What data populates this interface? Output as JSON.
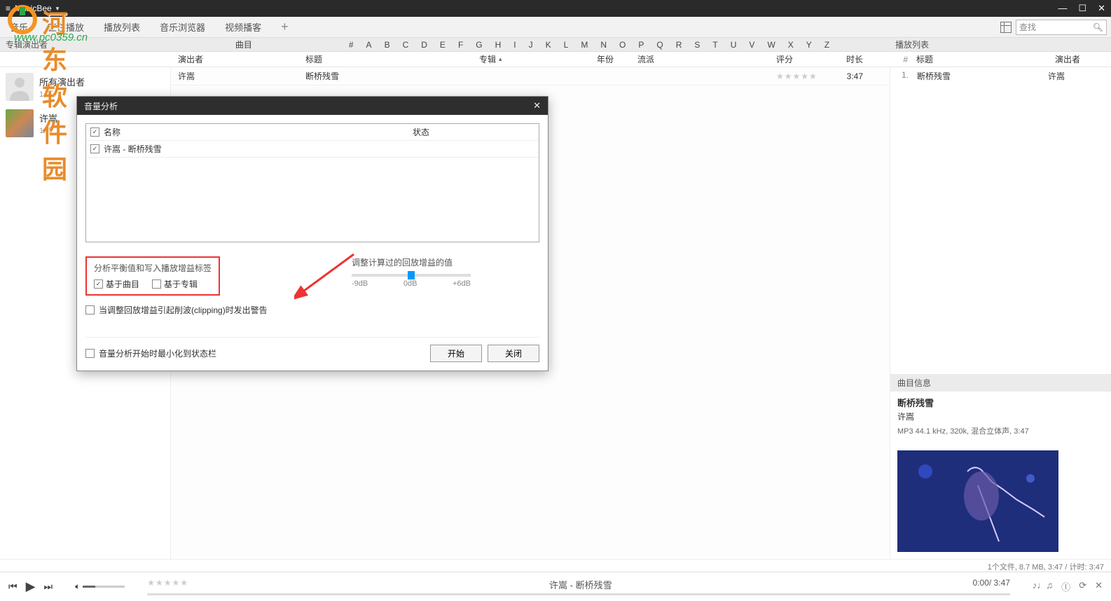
{
  "app": {
    "title": "MusicBee"
  },
  "window": {
    "min": "—",
    "max": "☐",
    "close": "✕"
  },
  "menu": {
    "items": [
      "音乐",
      "正在播放",
      "播放列表",
      "音乐浏览器",
      "视频播客"
    ],
    "search_placeholder": "查找"
  },
  "colstrip": {
    "left": "专辑演出者",
    "mid_prefix": "曲目",
    "alpha": [
      "#",
      "A",
      "B",
      "C",
      "D",
      "E",
      "F",
      "G",
      "H",
      "I",
      "J",
      "K",
      "L",
      "M",
      "N",
      "O",
      "P",
      "Q",
      "R",
      "S",
      "T",
      "U",
      "V",
      "W",
      "X",
      "Y",
      "Z"
    ],
    "right": "播放列表"
  },
  "headers": {
    "artist": "演出者",
    "title": "标题",
    "album": "专辑",
    "year": "年份",
    "genre": "流派",
    "rating": "评分",
    "length": "时长",
    "pl_idx": "#",
    "pl_title": "标题",
    "pl_artist": "演出者"
  },
  "sidebar": {
    "items": [
      {
        "name": "所有演出者",
        "count": "1 首"
      },
      {
        "name": "许嵩",
        "count": "1 首"
      }
    ]
  },
  "tracks": [
    {
      "artist": "许嵩",
      "title": "断桥残雪",
      "album": "",
      "year": "",
      "genre": "",
      "rating": "★★★★★",
      "length": "3:47"
    }
  ],
  "playlist": [
    {
      "idx": "1.",
      "title": "断桥残雪",
      "artist": "许嵩"
    }
  ],
  "trackinfo": {
    "header": "曲目信息",
    "title": "断桥残雪",
    "artist": "许嵩",
    "meta": "MP3 44.1 kHz, 320k, 混合立体声, 3:47"
  },
  "status": "1个文件, 8.7 MB, 3:47 /   计时: 3:47",
  "player": {
    "now_playing": "许嵩 - 断桥残雪",
    "time_l": "0:00/ 3:47",
    "stars": "★★★★★"
  },
  "dialog": {
    "title": "音量分析",
    "cols": {
      "name": "名称",
      "status": "状态"
    },
    "rows": [
      {
        "checked": true,
        "name": "许嵩 - 断桥残雪",
        "status": ""
      }
    ],
    "analysis_label": "分析平衡值和写入播放增益标签",
    "by_track": "基于曲目",
    "by_album": "基于专辑",
    "gain_label": "调整计算过的回放增益的值",
    "gain_ticks": [
      "-9dB",
      "0dB",
      "+6dB"
    ],
    "warn": "当调整回放增益引起削波(clipping)时发出警告",
    "minimize": "音量分析开始时最小化到状态栏",
    "start": "开始",
    "close": "关闭"
  },
  "watermark": {
    "t1": "河东软件园",
    "t2": "www.pc0359.cn"
  }
}
